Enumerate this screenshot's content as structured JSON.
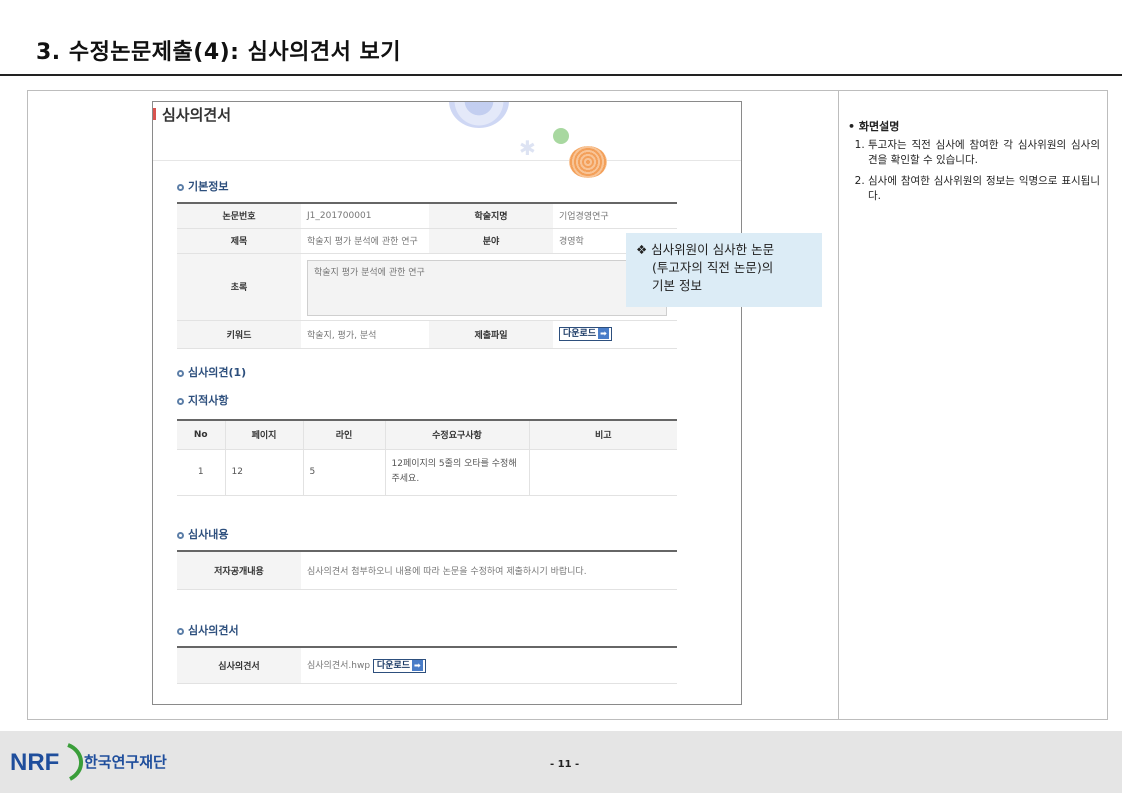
{
  "page": {
    "title": "3. 수정논문제출(4): 심사의견서 보기",
    "page_number": "- 11 -"
  },
  "screen": {
    "title": "심사의견서",
    "basic_info": {
      "heading": "기본정보",
      "labels": {
        "paper_no": "논문번호",
        "journal": "학술지명",
        "subject": "제목",
        "field": "분야",
        "abstract": "초록",
        "keywords": "키워드",
        "file": "제출파일"
      },
      "values": {
        "paper_no": "J1_201700001",
        "journal": "기업경영연구",
        "subject": "학술지 평가 분석에 관한 연구",
        "field": "경영학",
        "abstract": "학술지 평가 분석에 관한 연구",
        "keywords": "학술지, 평가, 분석"
      },
      "download_label": "다운로드"
    },
    "opinion": {
      "heading": "심사의견(1)",
      "points_heading": "지적사항",
      "columns": [
        "No",
        "페이지",
        "라인",
        "수정요구사항",
        "비고"
      ],
      "rows": [
        {
          "no": "1",
          "page": "12",
          "line": "5",
          "request": "12페이지의 5줄의 오타를 수정해 주세요.",
          "note": ""
        }
      ]
    },
    "review_content": {
      "heading": "심사내용",
      "label": "저자공개내용",
      "value": "심사의견서 첨부하오니 내용에 따라 논문을 수정하여 제출하시기 바랍니다."
    },
    "review_doc": {
      "heading": "심사의견서",
      "label": "심사의견서",
      "file": "심사의견서.hwp",
      "download_label": "다운로드"
    }
  },
  "tooltip": {
    "line1": "❖ 심사위원이 심사한 논문",
    "line2": "(투고자의 직전 논문)의",
    "line3": "기본 정보"
  },
  "description": {
    "title": "• 화면설명",
    "items": [
      "투고자는 직전 심사에 참여한 각 심사위원의 심사의견을 확인할 수 있습니다.",
      "심사에 참여한 심사위원의 정보는 익명으로 표시됩니다."
    ]
  },
  "footer": {
    "logo_text": "NRF",
    "org_name": "한국연구재단"
  },
  "colors": {
    "section_heading": "#2d4f7d",
    "tooltip_bg": "#dcecf6",
    "footer_bg": "#e5e5e5",
    "logo_blue": "#1f4e9c",
    "logo_green": "#3a9e3a"
  }
}
